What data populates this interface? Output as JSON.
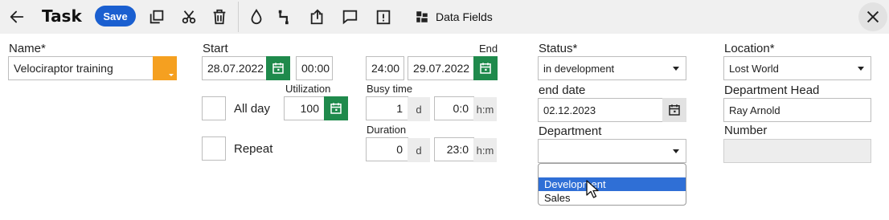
{
  "toolbar": {
    "title": "Task",
    "save_label": "Save",
    "data_fields_label": "Data Fields"
  },
  "form": {
    "name_label": "Name*",
    "name_value": "Velociraptor training",
    "start_label": "Start",
    "start_date": "28.07.2022",
    "start_time": "00:00",
    "end_label": "End",
    "end_time": "24:00",
    "end_date": "29.07.2022",
    "utilization_label": "Utilization",
    "utilization_value": "100",
    "all_day_label": "All day",
    "repeat_label": "Repeat",
    "busy_time_label": "Busy time",
    "busy_days": "1",
    "busy_days_unit": "d",
    "busy_hm": "0:0",
    "busy_hm_unit": "h:m",
    "duration_label": "Duration",
    "duration_days": "0",
    "duration_days_unit": "d",
    "duration_hm": "23:0",
    "duration_hm_unit": "h:m",
    "status_label": "Status*",
    "status_value": "in development",
    "end_date_label": "end date",
    "end_date_value": "02.12.2023",
    "department_label": "Department",
    "department_value": "",
    "department_options": [
      "",
      "Development",
      "Sales"
    ],
    "location_label": "Location*",
    "location_value": "Lost World",
    "dept_head_label": "Department Head",
    "dept_head_value": "Ray Arnold",
    "number_label": "Number",
    "number_value": ""
  },
  "colors": {
    "save_bg": "#1a5fd0",
    "calendar_green": "#1f8a4c",
    "name_accent_orange": "#f5a020",
    "dropdown_selected": "#2f6fd6"
  },
  "icons": [
    "back-arrow-icon",
    "copy-icon",
    "cut-icon",
    "delete-icon",
    "water-drop-icon",
    "link-icon",
    "export-icon",
    "comment-icon",
    "history-icon",
    "data-fields-icon",
    "close-icon",
    "calendar-icon"
  ]
}
